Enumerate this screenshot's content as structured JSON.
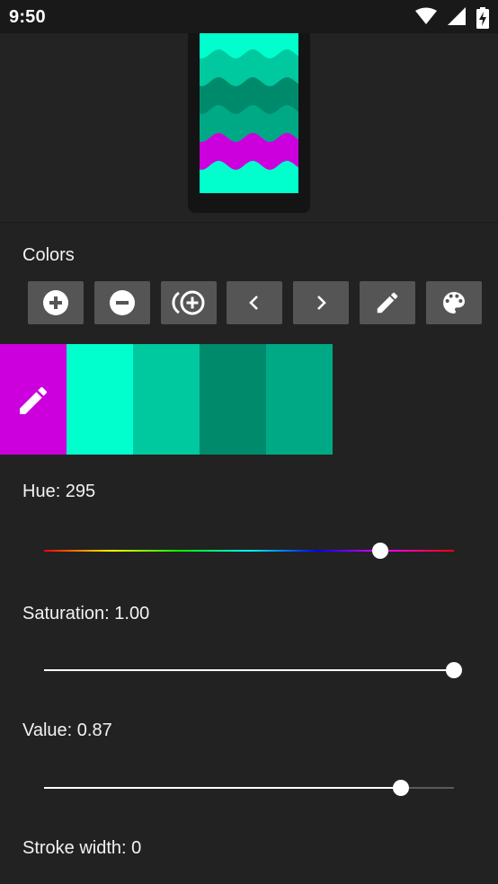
{
  "status_bar": {
    "time": "9:50",
    "icons": [
      "wifi-icon",
      "cellular-signal-icon",
      "battery-charging-icon"
    ]
  },
  "preview": {
    "wave_colors": [
      "#00ffcc",
      "#00c89f",
      "#008a6c",
      "#00a985",
      "#cc00dd",
      "#00ffcc"
    ]
  },
  "colors_section": {
    "title": "Colors",
    "toolbar": [
      {
        "name": "add-color-button",
        "icon": "plus-circle-icon"
      },
      {
        "name": "remove-color-button",
        "icon": "minus-circle-icon"
      },
      {
        "name": "duplicate-color-button",
        "icon": "add-circle-stack-icon"
      },
      {
        "name": "move-left-button",
        "icon": "chevron-left-icon"
      },
      {
        "name": "move-right-button",
        "icon": "chevron-right-icon"
      },
      {
        "name": "edit-color-button",
        "icon": "pencil-icon"
      },
      {
        "name": "palette-button",
        "icon": "palette-icon"
      }
    ],
    "swatches": [
      {
        "color": "#cc00dd",
        "selected": true
      },
      {
        "color": "#00ffcc",
        "selected": false
      },
      {
        "color": "#00c89f",
        "selected": false
      },
      {
        "color": "#008a6c",
        "selected": false
      },
      {
        "color": "#00a985",
        "selected": false
      }
    ]
  },
  "controls": {
    "hue": {
      "label": "Hue: 295",
      "value": 295,
      "min": 0,
      "max": 360
    },
    "saturation": {
      "label": "Saturation: 1.00",
      "value": 1.0,
      "min": 0,
      "max": 1
    },
    "value": {
      "label": "Value: 0.87",
      "value": 0.87,
      "min": 0,
      "max": 1
    },
    "stroke_width": {
      "label": "Stroke width: 0"
    }
  }
}
